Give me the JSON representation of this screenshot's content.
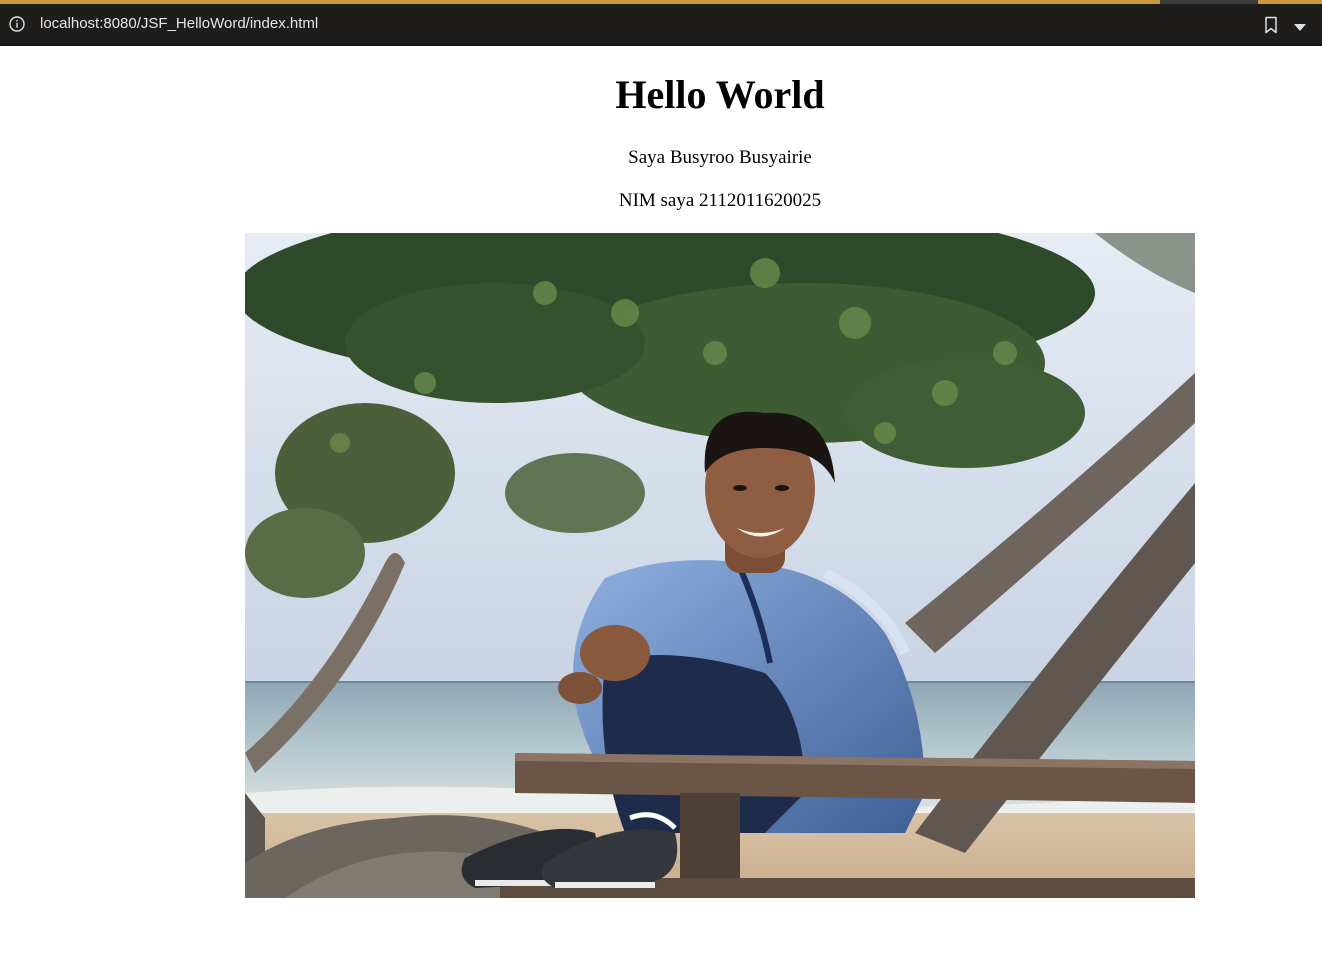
{
  "browser": {
    "url": "localhost:8080/JSF_HelloWord/index.html",
    "icons": {
      "info": "info-circle-icon",
      "bookmark": "bookmark-icon",
      "menu": "chevron-down-icon"
    },
    "accent_color": "#c79a3e"
  },
  "page": {
    "heading": "Hello World",
    "name_text": "Saya Busyroo Busyairie",
    "nim_text": "NIM saya 2112011620025",
    "photo": {
      "subject": "Smiling young man in a blue track jacket sitting on a wooden bench at a beach under trees"
    }
  }
}
